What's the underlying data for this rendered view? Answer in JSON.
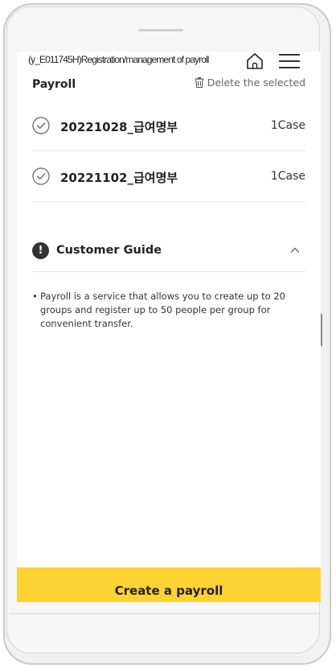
{
  "top_bar": {
    "screen_id_label": "(y_E011745H)Registration/management   of payroll",
    "home_icon": "home-icon",
    "menu_icon": "hamburger-menu-icon"
  },
  "payroll_section": {
    "title": "Payroll",
    "delete_label": "Delete the selected",
    "delete_icon": "trash-icon"
  },
  "payrolls": [
    {
      "name": "20221028_급여명부",
      "count": "1Case"
    },
    {
      "name": "20221102_급여명부",
      "count": "1Case"
    }
  ],
  "customer_guide": {
    "title": "Customer Guide",
    "icon": "exclamation-icon",
    "toggle_icon": "chevron-up-icon",
    "bullet": "•",
    "text": "Payroll is a service that allows you to create up to 20 groups and register up to 50 people per group for convenient transfer."
  },
  "footer": {
    "create_label": "Create a payroll"
  },
  "colors": {
    "accent_yellow": "#fdd334",
    "text_dark": "#222222",
    "divider": "#e6e6e6"
  }
}
